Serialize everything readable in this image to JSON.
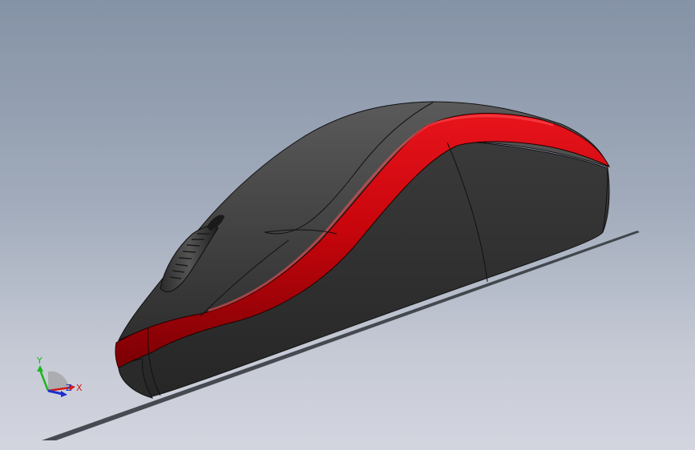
{
  "viewport": {
    "background_top": "#8593a6",
    "background_bottom": "#d3d5df"
  },
  "model": {
    "body_color": "#3a3a3a",
    "stripe_color": "#c8050c",
    "edge_color": "#111111"
  },
  "triad": {
    "y_label": "Y",
    "x_label": "X",
    "z_label": "Z",
    "y_color": "#1fb51f",
    "x_color": "#d11a1a",
    "z_color": "#1a2fd1"
  }
}
